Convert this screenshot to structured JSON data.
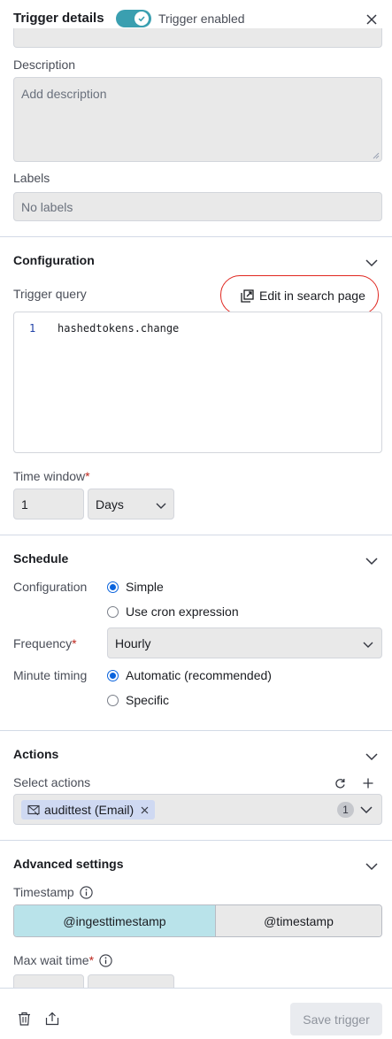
{
  "header": {
    "title": "Trigger details",
    "toggle_label": "Trigger enabled",
    "toggle_on": true
  },
  "details": {
    "description_label": "Description",
    "description_placeholder": "Add description",
    "labels_label": "Labels",
    "labels_placeholder": "No labels"
  },
  "configuration": {
    "title": "Configuration",
    "query_label": "Trigger query",
    "edit_link": "Edit in search page",
    "query_lines": [
      {
        "num": "1",
        "text": "hashedtokens.change"
      }
    ],
    "time_window_label": "Time window",
    "required_mark": "*",
    "time_value": "1",
    "time_unit": "Days"
  },
  "schedule": {
    "title": "Schedule",
    "config_label": "Configuration",
    "options": [
      "Simple",
      "Use cron expression"
    ],
    "selected_option": "Simple",
    "frequency_label": "Frequency",
    "frequency_value": "Hourly",
    "minute_timing_label": "Minute timing",
    "timing_options": [
      "Automatic (recommended)",
      "Specific"
    ],
    "selected_timing": "Automatic (recommended)"
  },
  "actions": {
    "title": "Actions",
    "select_label": "Select actions",
    "chip_label": "audittest (Email)",
    "count": "1"
  },
  "advanced": {
    "title": "Advanced settings",
    "timestamp_label": "Timestamp",
    "timestamp_options": [
      "@ingesttimestamp",
      "@timestamp"
    ],
    "selected_timestamp": "@ingesttimestamp",
    "max_wait_label": "Max wait time"
  },
  "footer": {
    "save_label": "Save trigger"
  },
  "colors": {
    "accent": "#0b64dd",
    "toggle": "#3a9fb0",
    "selected_segment": "#b9e3ea",
    "highlight_circle": "#e0261f"
  }
}
